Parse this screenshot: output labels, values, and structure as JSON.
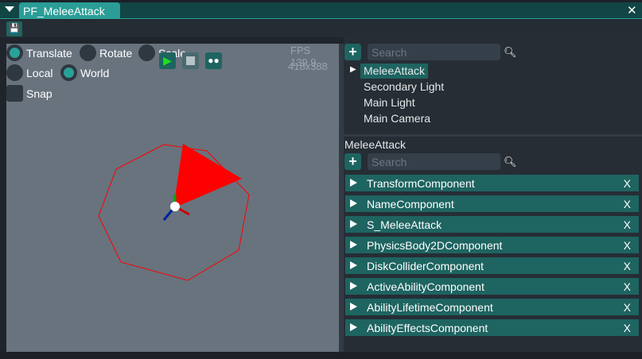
{
  "window": {
    "tab_title": "PF_MeleeAttack",
    "close": "✕",
    "save_icon": "save-icon"
  },
  "viewport": {
    "gizmo_modes": [
      {
        "label": "Translate",
        "selected": true
      },
      {
        "label": "Rotate",
        "selected": false
      },
      {
        "label": "Scale",
        "selected": false
      }
    ],
    "spaces": [
      {
        "label": "Local",
        "selected": false
      },
      {
        "label": "World",
        "selected": true
      }
    ],
    "snap_label": "Snap",
    "fps": "FPS 139.9",
    "resolution": "418x388",
    "play_color": "#22dd22"
  },
  "hierarchy": {
    "search_placeholder": "Search",
    "items": [
      {
        "label": "MeleeAttack",
        "selected": true,
        "expandable": true
      },
      {
        "label": "Secondary Light"
      },
      {
        "label": "Main Light"
      },
      {
        "label": "Main Camera"
      }
    ]
  },
  "inspector": {
    "entity_name": "MeleeAttack",
    "search_placeholder": "Search",
    "remove_label": "X",
    "components": [
      "TransformComponent",
      "NameComponent",
      "S_MeleeAttack",
      "PhysicsBody2DComponent",
      "DiskColliderComponent",
      "ActiveAbilityComponent",
      "AbilityLifetimeComponent",
      "AbilityEffectsComponent"
    ]
  }
}
